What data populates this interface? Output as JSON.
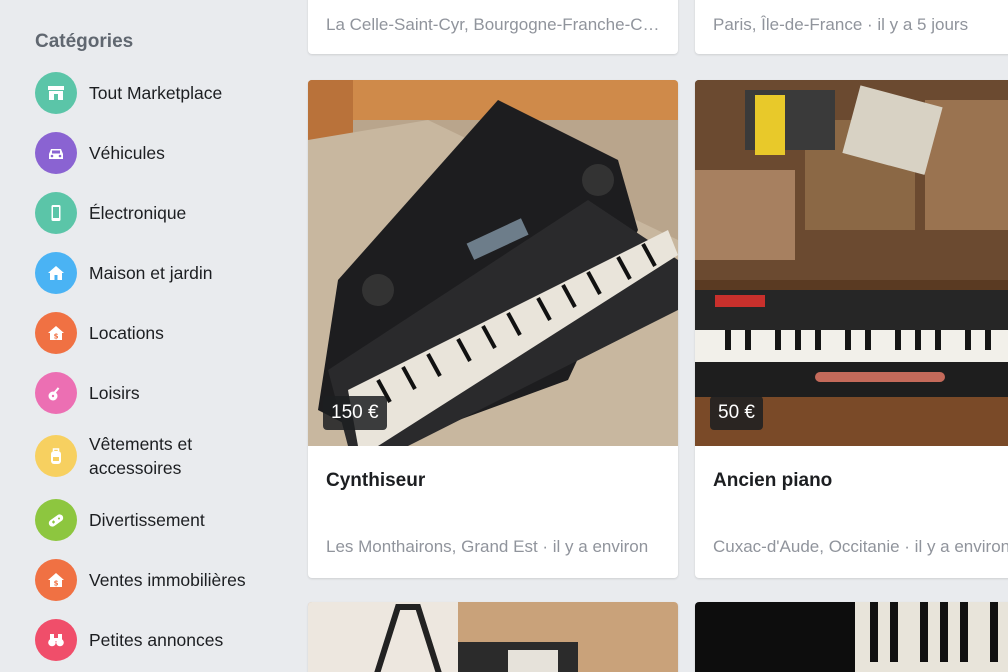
{
  "sidebar": {
    "title": "Catégories",
    "items": [
      {
        "label": "Tout Marketplace",
        "color": "#5bc5a8",
        "icon": "store-icon"
      },
      {
        "label": "Véhicules",
        "color": "#8a63d2",
        "icon": "car-icon"
      },
      {
        "label": "Électronique",
        "color": "#5bc5a8",
        "icon": "phone-icon"
      },
      {
        "label": "Maison et jardin",
        "color": "#4ab3f4",
        "icon": "house-icon"
      },
      {
        "label": "Locations",
        "color": "#f07143",
        "icon": "rental-house-icon"
      },
      {
        "label": "Loisirs",
        "color": "#ec6fb3",
        "icon": "guitar-icon"
      },
      {
        "label": "Vêtements et accessoires",
        "color": "#f7d060",
        "icon": "backpack-icon"
      },
      {
        "label": "Divertissement",
        "color": "#8dc63f",
        "icon": "gamepad-icon"
      },
      {
        "label": "Ventes immobilières",
        "color": "#f07143",
        "icon": "sale-house-icon"
      },
      {
        "label": "Petites annonces",
        "color": "#f04e6a",
        "icon": "binoculars-icon"
      }
    ]
  },
  "listings": {
    "top_partial": [
      {
        "location": "La Celle-Saint-Cyr, Bourgogne-Franche-Comté"
      },
      {
        "location": "Paris, Île-de-France · il y a 5 jours"
      }
    ],
    "main": [
      {
        "price": "150 €",
        "title": "Cynthiseur",
        "location": "Les Monthairons, Grand Est · il y a environ"
      },
      {
        "price": "50 €",
        "title": "Ancien piano",
        "location": "Cuxac-d'Aude, Occitanie · il y a environ"
      }
    ]
  }
}
